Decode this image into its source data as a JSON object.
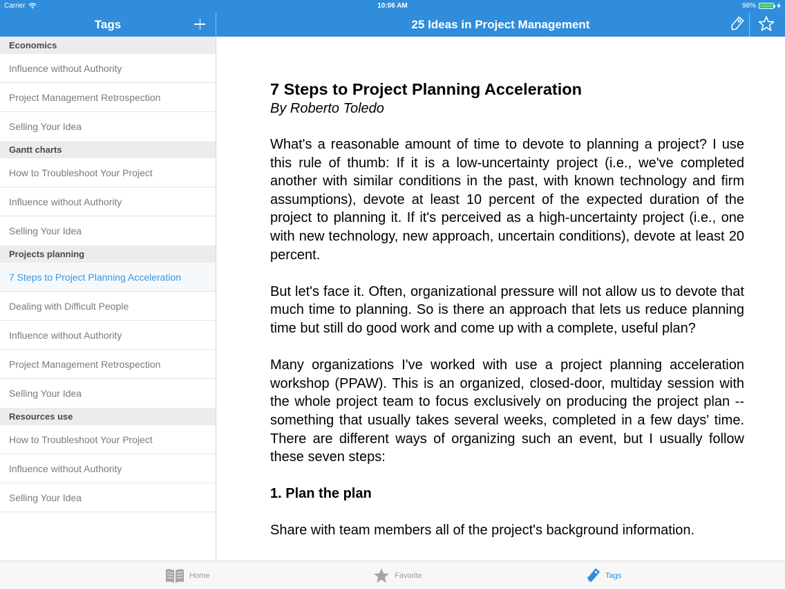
{
  "status": {
    "carrier": "Carrier",
    "time": "10:06 AM",
    "battery_text": "98%",
    "battery_level": 0.98
  },
  "sidebar": {
    "title": "Tags",
    "sections": [
      {
        "header": "Economics",
        "items": [
          "Influence without Authority",
          "Project Management Retrospection",
          "Selling Your Idea"
        ]
      },
      {
        "header": "Gantt charts",
        "items": [
          "How to Troubleshoot Your Project",
          "Influence without Authority",
          "Selling Your Idea"
        ]
      },
      {
        "header": "Projects planning",
        "items": [
          "7 Steps to Project Planning Acceleration",
          "Dealing with Difficult People",
          "Influence without Authority",
          "Project Management Retrospection",
          "Selling Your Idea"
        ]
      },
      {
        "header": "Resources use",
        "items": [
          "How to Troubleshoot Your Project",
          "Influence without Authority",
          "Selling Your Idea"
        ]
      }
    ]
  },
  "header": {
    "title": "25 Ideas in Project Management"
  },
  "article": {
    "title": "7 Steps to Project Planning Acceleration",
    "byline": "By Roberto Toledo",
    "p1": "What's a reasonable amount of time to devote to planning a project? I use this rule of thumb: If it is a low-uncertainty project (i.e., we've completed another with similar conditions in the past, with known technology and firm assumptions), devote at least 10 percent of the expected duration of the project to planning it. If it's perceived as a high-uncertainty project (i.e., one with new technology, new approach, uncertain conditions), devote at least 20 percent.",
    "p2": "But let's face it. Often, organizational pressure will not allow us to devote that much time to planning. So is there an approach that lets us reduce planning time but still do good work and come up with a complete, useful plan?",
    "p3": "Many organizations I've worked with use a project planning acceleration workshop (PPAW). This is an organized, closed-door, multiday session with the whole project team to focus exclusively on producing the project plan -- something that usually takes several weeks, completed in a few days' time. There are different ways of organizing such an event, but I usually follow these seven steps:",
    "h2": "1. Plan the plan",
    "p4": "Share with team members all of the project's background information."
  },
  "tabbar": {
    "home": "Home",
    "favorite": "Favorite",
    "tags": "Tags"
  },
  "colors": {
    "accent": "#2f8ddb",
    "selected_text": "#3c94d8",
    "battery": "#4cd964"
  }
}
